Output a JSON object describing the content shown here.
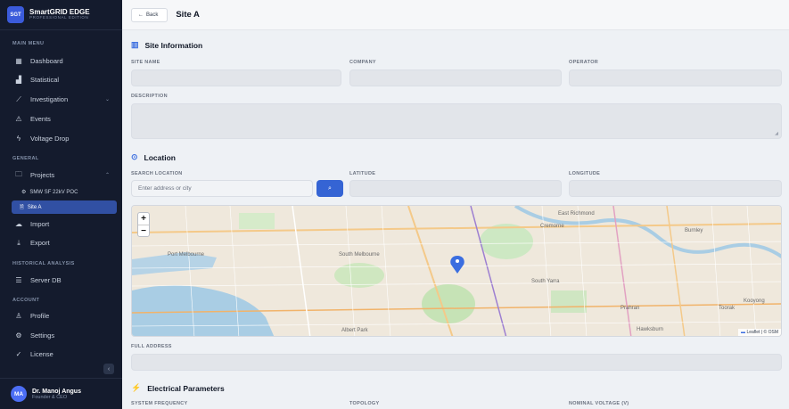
{
  "brand": {
    "logo": "SGT",
    "title": "SmartGRID EDGE",
    "subtitle": "PROFESSIONAL EDITION"
  },
  "sidebar": {
    "sections": {
      "main": "MAIN MENU",
      "general": "GENERAL",
      "historical": "HISTORICAL ANALYSIS",
      "account": "ACCOUNT"
    },
    "items": {
      "dashboard": "Dashboard",
      "statistical": "Statistical",
      "investigation": "Investigation",
      "events": "Events",
      "voltage_drop": "Voltage Drop",
      "projects": "Projects",
      "project_sub": "SMW SF 22kV POC",
      "site_active": "Site A",
      "import": "Import",
      "export": "Export",
      "server_db": "Server DB",
      "profile": "Profile",
      "settings": "Settings",
      "license": "License"
    },
    "icons": {
      "dashboard": "grid-icon",
      "statistical": "bar-chart-icon",
      "investigation": "trend-icon",
      "events": "warning-icon",
      "voltage_drop": "bolt-icon",
      "projects": "folder-icon",
      "import": "cloud-upload-icon",
      "export": "download-icon",
      "server_db": "database-icon",
      "profile": "user-icon",
      "settings": "gear-icon",
      "license": "check-circle-icon"
    }
  },
  "user": {
    "initials": "MA",
    "name": "Dr. Manoj Angus",
    "role": "Founder & CEO"
  },
  "header": {
    "back_label": "Back",
    "title": "Site A"
  },
  "site_info": {
    "heading": "Site Information",
    "site_name_label": "SITE NAME",
    "company_label": "COMPANY",
    "operator_label": "OPERATOR",
    "description_label": "DESCRIPTION"
  },
  "location": {
    "heading": "Location",
    "search_label": "SEARCH LOCATION",
    "search_placeholder": "Enter address or city",
    "latitude_label": "LATITUDE",
    "longitude_label": "LONGITUDE",
    "full_address_label": "FULL ADDRESS"
  },
  "map": {
    "labels": [
      "Port Melbourne",
      "South Melbourne",
      "Albert Park",
      "Cremorne",
      "Burnley",
      "East Richmond",
      "South Yarra",
      "Hawksburn",
      "Toorak",
      "Kooyong",
      "Prahran"
    ],
    "attribution_leaflet": "Leaflet",
    "attribution_osm": "© OSM",
    "zoom_in": "+",
    "zoom_out": "−"
  },
  "electrical": {
    "heading": "Electrical Parameters",
    "system_frequency_label": "SYSTEM FREQUENCY",
    "topology_label": "TOPOLOGY",
    "nominal_voltage_label": "NOMINAL VOLTAGE (V)"
  },
  "colors": {
    "accent": "#3564d4",
    "sidebar_bg": "#141b2d",
    "active_item": "#3150a3"
  }
}
